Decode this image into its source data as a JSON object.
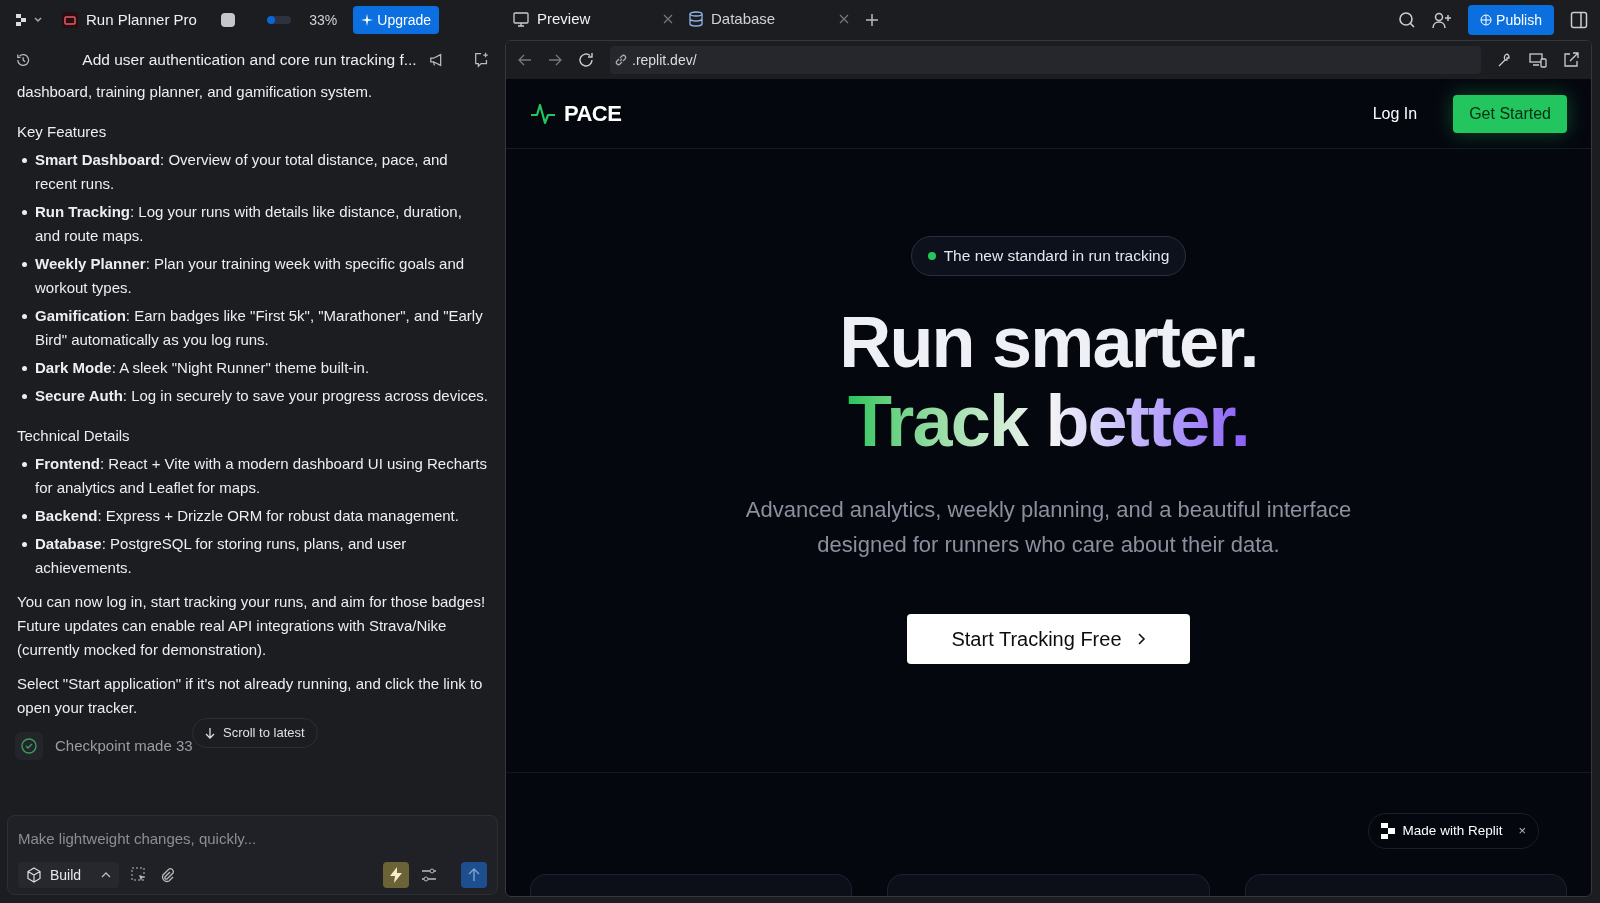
{
  "topbar": {
    "project": "Run Planner Pro",
    "progress": {
      "level": 0.33,
      "reading": "33%"
    },
    "upgrade": "Upgrade",
    "tabs": [
      {
        "label": "Preview",
        "kind": "preview",
        "selected": true
      },
      {
        "label": "Database",
        "kind": "database",
        "selected": false
      }
    ],
    "publish": "Publish"
  },
  "chat": {
    "title": "Add user authentication and core run tracking f...",
    "blocks": [
      {
        "kind": "paragraph",
        "text": "dashboard, training planner, and gamification system."
      },
      {
        "kind": "heading",
        "text": "Key Features"
      },
      {
        "kind": "bullets",
        "items": [
          "**Smart Dashboard**: Overview of your total distance, pace, and recent runs.",
          "**Run Tracking**: Log your runs with details like distance, duration, and route maps.",
          "**Weekly Planner**: Plan your training week with specific goals and workout types.",
          "**Gamification**: Earn badges like \"First 5k\", \"Marathoner\", and \"Early Bird\" automatically as you log runs.",
          "**Dark Mode**: A sleek \"Night Runner\" theme built-in.",
          "**Secure Auth**: Log in securely to save your progress across devices."
        ]
      },
      {
        "kind": "heading",
        "text": "Technical Details"
      },
      {
        "kind": "bullets",
        "items": [
          "**Frontend**: React + Vite with a modern dashboard UI using Recharts for analytics and Leaflet for maps.",
          "**Backend**: Express + Drizzle ORM for robust data management.",
          "**Database**: PostgreSQL for storing runs, plans, and user achievements."
        ]
      },
      {
        "kind": "paragraph",
        "text": "You can now log in, start tracking your runs, and aim for those badges! Future updates can enable real API integrations with Strava/Nike (currently mocked for demonstration)."
      },
      {
        "kind": "paragraph",
        "text": "Select \"Start application\" if it's not already running, and click the link to open your tracker."
      }
    ],
    "checkpoint": "Checkpoint made 33",
    "scroll_button": "Scroll to latest",
    "input": {
      "placeholder": "Make lightweight changes, quickly..."
    },
    "mode": "Build"
  },
  "browser": {
    "url": ".replit.dev/"
  },
  "site": {
    "logo": "PACE",
    "login": "Log In",
    "get_started": "Get Started",
    "badge": "The new standard in run tracking",
    "headline": [
      "Run smarter.",
      "Track better."
    ],
    "subtitle": "Advanced analytics, weekly planning, and a beautiful interface designed for runners who care about their data.",
    "cta": "Start Tracking Free",
    "made_with": "Made with Replit",
    "made_with_close": "×"
  }
}
